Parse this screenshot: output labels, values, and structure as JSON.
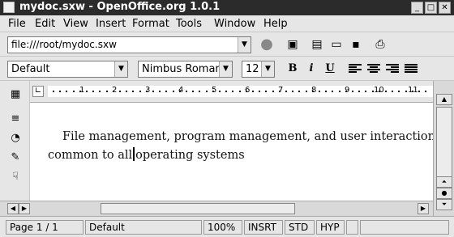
{
  "window": {
    "title": "mydoc.sxw - OpenOffice.org 1.0.1"
  },
  "menu": [
    {
      "label": "File"
    },
    {
      "label": "Edit"
    },
    {
      "label": "View"
    },
    {
      "label": "Insert"
    },
    {
      "label": "Format"
    },
    {
      "label": "Tools"
    },
    {
      "label": "Window"
    },
    {
      "label": "Help"
    }
  ],
  "toolbar": {
    "url": "file:///root/mydoc.sxw"
  },
  "formatting": {
    "style": "Default",
    "font": "Nimbus Roman",
    "size": "12",
    "bold": "B",
    "italic": "i",
    "underline": "U"
  },
  "ruler": {
    "numbers": [
      "1",
      "2",
      "3",
      "4",
      "5",
      "6",
      "7",
      "8",
      "9",
      "10",
      "11"
    ]
  },
  "document": {
    "line1": "File management, program management, and user interaction are",
    "line2_before_cursor": "common to all",
    "line2_after_cursor": "operating systems"
  },
  "status": {
    "page": "Page 1 / 1",
    "style": "Default",
    "zoom": "100%",
    "insert_mode": "INSRT",
    "selection_mode": "STD",
    "hyphenation": "HYP"
  }
}
